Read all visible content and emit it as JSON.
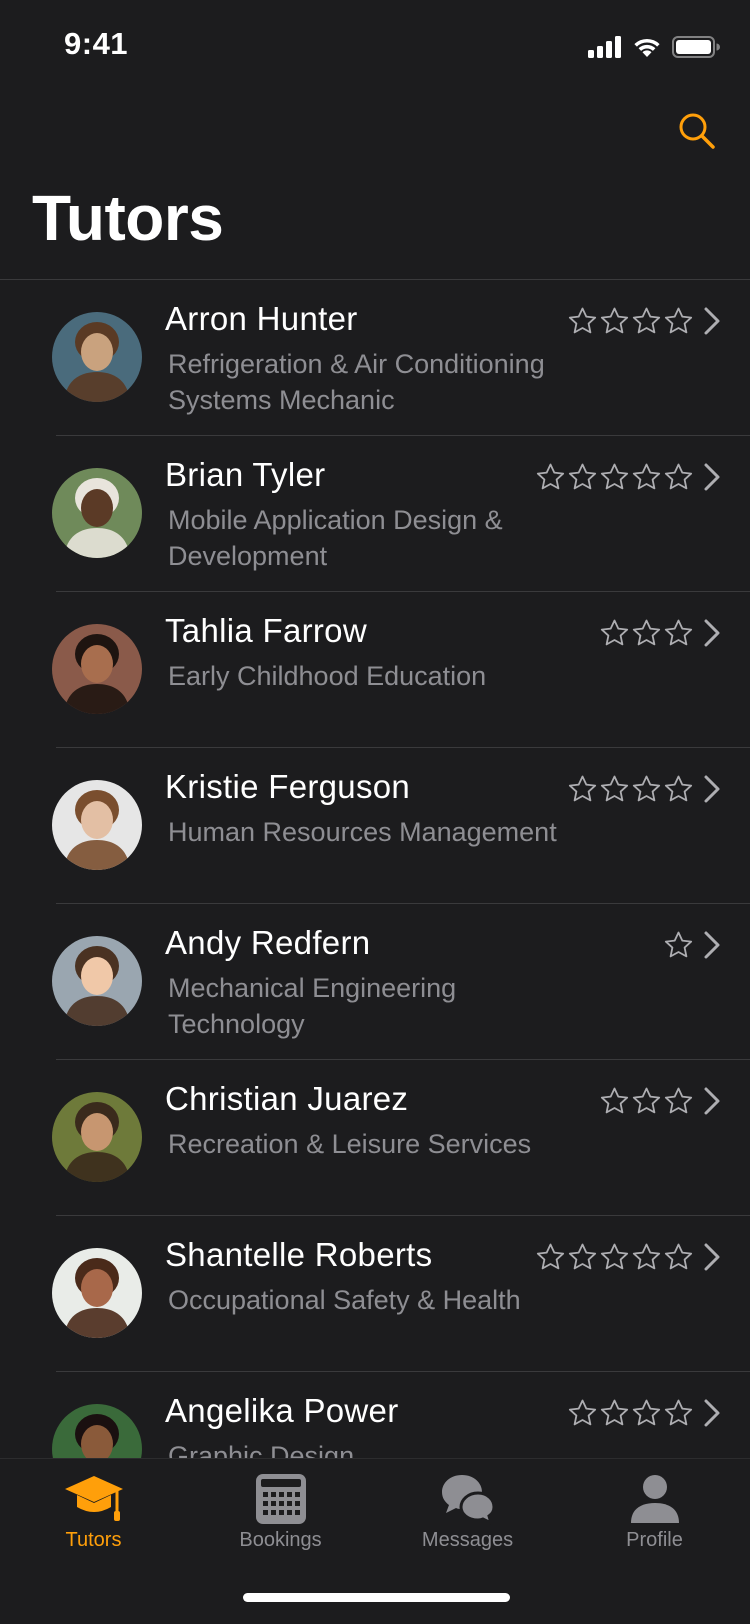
{
  "status_bar": {
    "time": "9:41"
  },
  "colors": {
    "accent": "#ff9f0a",
    "background": "#1c1c1e",
    "secondary_text": "#8e8e93",
    "divider": "#3a3a3c"
  },
  "header": {
    "title": "Tutors",
    "search_icon": "search-icon"
  },
  "tutors": [
    {
      "name": "Arron Hunter",
      "subject": "Refrigeration & Air Conditioning Systems Mechanic",
      "stars": 4,
      "avatar": "avatar-photo"
    },
    {
      "name": "Brian Tyler",
      "subject": "Mobile Application Design & Development",
      "stars": 5,
      "avatar": "avatar-photo"
    },
    {
      "name": "Tahlia Farrow",
      "subject": "Early Childhood Education",
      "stars": 3,
      "avatar": "avatar-photo"
    },
    {
      "name": "Kristie Ferguson",
      "subject": "Human Resources Management",
      "stars": 4,
      "avatar": "avatar-photo"
    },
    {
      "name": "Andy Redfern",
      "subject": "Mechanical Engineering Technology",
      "stars": 1,
      "avatar": "avatar-photo"
    },
    {
      "name": "Christian Juarez",
      "subject": "Recreation & Leisure Services",
      "stars": 3,
      "avatar": "avatar-photo"
    },
    {
      "name": "Shantelle Roberts",
      "subject": "Occupational Safety & Health",
      "stars": 5,
      "avatar": "avatar-photo"
    },
    {
      "name": "Angelika Power",
      "subject": "Graphic Design",
      "stars": 4,
      "avatar": "avatar-photo"
    }
  ],
  "tab_bar": {
    "tabs": [
      {
        "label": "Tutors",
        "icon": "graduation-cap-icon",
        "active": true
      },
      {
        "label": "Bookings",
        "icon": "calendar-icon",
        "active": false
      },
      {
        "label": "Messages",
        "icon": "chat-bubbles-icon",
        "active": false
      },
      {
        "label": "Profile",
        "icon": "person-icon",
        "active": false
      }
    ]
  }
}
